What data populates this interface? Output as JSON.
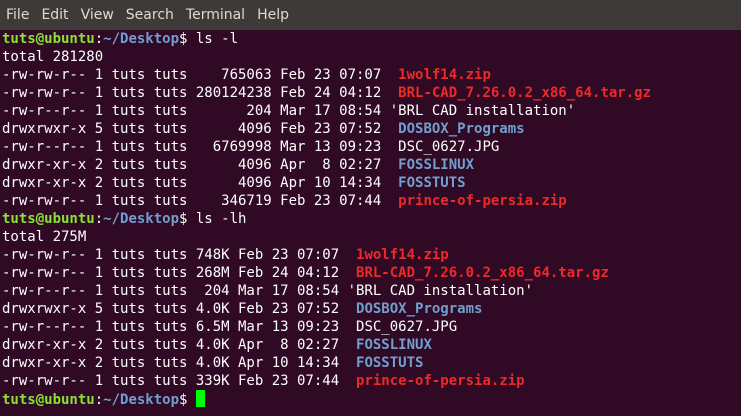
{
  "menubar": {
    "items": [
      "File",
      "Edit",
      "View",
      "Search",
      "Terminal",
      "Help"
    ]
  },
  "prompt": {
    "user_host": "tuts@ubuntu",
    "separator": ":",
    "path": "~/Desktop",
    "symbol": "$ "
  },
  "sessions": [
    {
      "command": "ls -l",
      "total": "total 281280",
      "entries": [
        {
          "meta": "-rw-rw-r-- 1 tuts tuts    765063 Feb 23 07:07  ",
          "name": "1wolf14.zip",
          "kind": "archive"
        },
        {
          "meta": "-rw-rw-r-- 1 tuts tuts 280124238 Feb 24 04:12  ",
          "name": "BRL-CAD_7.26.0.2_x86_64.tar.gz",
          "kind": "archive"
        },
        {
          "meta": "-rw-r--r-- 1 tuts tuts       204 Mar 17 08:54 ",
          "name": "'BRL CAD installation'",
          "kind": "file"
        },
        {
          "meta": "drwxrwxr-x 5 tuts tuts      4096 Feb 23 07:52  ",
          "name": "DOSBOX_Programs",
          "kind": "dir"
        },
        {
          "meta": "-rw-r--r-- 1 tuts tuts   6769998 Mar 13 09:23  ",
          "name": "DSC_0627.JPG",
          "kind": "file"
        },
        {
          "meta": "drwxr-xr-x 2 tuts tuts      4096 Apr  8 02:27  ",
          "name": "FOSSLINUX",
          "kind": "dir"
        },
        {
          "meta": "drwxr-xr-x 2 tuts tuts      4096 Apr 10 14:34  ",
          "name": "FOSSTUTS",
          "kind": "dir"
        },
        {
          "meta": "-rw-rw-r-- 1 tuts tuts    346719 Feb 23 07:44  ",
          "name": "prince-of-persia.zip",
          "kind": "archive"
        }
      ]
    },
    {
      "command": "ls -lh",
      "total": "total 275M",
      "entries": [
        {
          "meta": "-rw-rw-r-- 1 tuts tuts 748K Feb 23 07:07  ",
          "name": "1wolf14.zip",
          "kind": "archive"
        },
        {
          "meta": "-rw-rw-r-- 1 tuts tuts 268M Feb 24 04:12  ",
          "name": "BRL-CAD_7.26.0.2_x86_64.tar.gz",
          "kind": "archive"
        },
        {
          "meta": "-rw-r--r-- 1 tuts tuts  204 Mar 17 08:54 ",
          "name": "'BRL CAD installation'",
          "kind": "file"
        },
        {
          "meta": "drwxrwxr-x 5 tuts tuts 4.0K Feb 23 07:52  ",
          "name": "DOSBOX_Programs",
          "kind": "dir"
        },
        {
          "meta": "-rw-r--r-- 1 tuts tuts 6.5M Mar 13 09:23  ",
          "name": "DSC_0627.JPG",
          "kind": "file"
        },
        {
          "meta": "drwxr-xr-x 2 tuts tuts 4.0K Apr  8 02:27  ",
          "name": "FOSSLINUX",
          "kind": "dir"
        },
        {
          "meta": "drwxr-xr-x 2 tuts tuts 4.0K Apr 10 14:34  ",
          "name": "FOSSTUTS",
          "kind": "dir"
        },
        {
          "meta": "-rw-rw-r-- 1 tuts tuts 339K Feb 23 07:44  ",
          "name": "prince-of-persia.zip",
          "kind": "archive"
        }
      ]
    }
  ],
  "colors": {
    "background": "#300a24",
    "menubar": "#3c3b37",
    "prompt_user": "#8ae234",
    "prompt_path": "#729fcf",
    "archive": "#ef2929",
    "directory": "#729fcf",
    "cursor": "#00ff00"
  }
}
